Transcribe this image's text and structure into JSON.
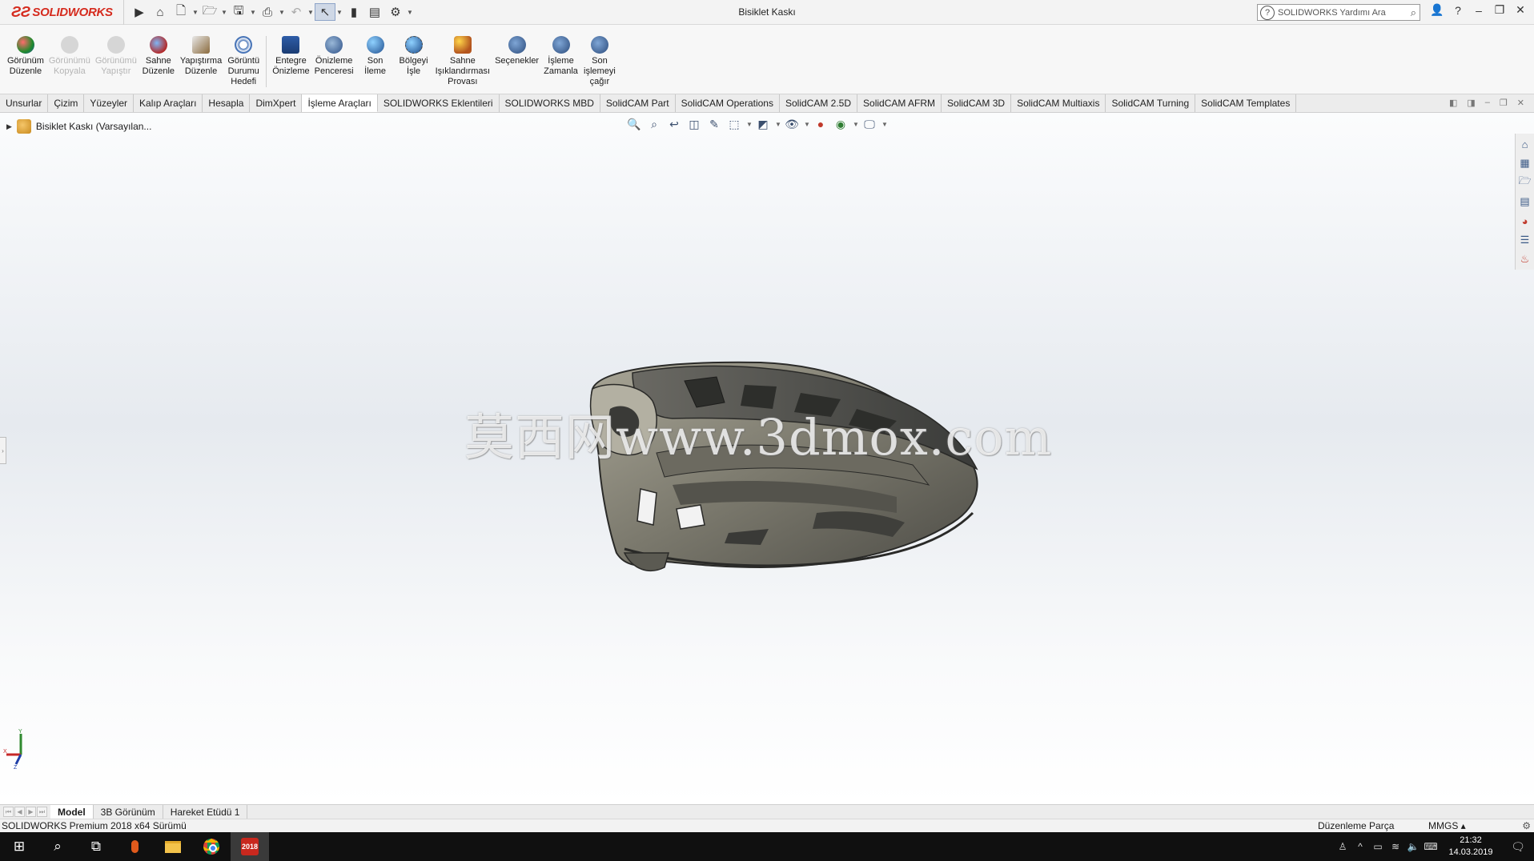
{
  "app": {
    "brand": "SOLIDWORKS",
    "window_title": "Bisiklet Kaskı",
    "help_search_placeholder": "SOLIDWORKS Yardımı Ara"
  },
  "ribbon": {
    "buttons": [
      {
        "label": "Görünüm\nDüzenle",
        "enabled": true
      },
      {
        "label": "Görünümü\nKopyala",
        "enabled": false
      },
      {
        "label": "Görünümü\nYapıştır",
        "enabled": false
      },
      {
        "label": "Sahne\nDüzenle",
        "enabled": true
      },
      {
        "label": "Yapıştırma\nDüzenle",
        "enabled": true
      },
      {
        "label": "Görüntü\nDurumu\nHedefi",
        "enabled": true
      },
      {
        "label": "Entegre\nÖnizleme",
        "enabled": true
      },
      {
        "label": "Önizleme\nPenceresi",
        "enabled": true
      },
      {
        "label": "Son\nİleme",
        "enabled": true
      },
      {
        "label": "Bölgeyi\nİşle",
        "enabled": true
      },
      {
        "label": "Sahne\nIşıklandırması\nProvası",
        "enabled": true
      },
      {
        "label": "Seçenekler",
        "enabled": true
      },
      {
        "label": "İşleme\nZamanla",
        "enabled": true
      },
      {
        "label": "Son\nişlemeyi\nçağır",
        "enabled": true
      }
    ]
  },
  "tabs": [
    "Unsurlar",
    "Çizim",
    "Yüzeyler",
    "Kalıp Araçları",
    "Hesapla",
    "DimXpert",
    "İşleme Araçları",
    "SOLIDWORKS Eklentileri",
    "SOLIDWORKS MBD",
    "SolidCAM Part",
    "SolidCAM Operations",
    "SolidCAM 2.5D",
    "SolidCAM AFRM",
    "SolidCAM 3D",
    "SolidCAM Multiaxis",
    "SolidCAM Turning",
    "SolidCAM Templates"
  ],
  "active_tab": "İşleme Araçları",
  "feature_tree": {
    "root_label": "Bisiklet Kaskı  (Varsayılan..."
  },
  "watermark": "莫西网www.3dmox.com",
  "triad": {
    "x": "X",
    "y": "Y",
    "z": "Z"
  },
  "bottom_tabs": [
    "Model",
    "3B Görünüm",
    "Hareket Etüdü 1"
  ],
  "active_bottom_tab": "Model",
  "status": {
    "version": "SOLIDWORKS Premium 2018 x64 Sürümü",
    "mode": "Düzenleme Parça",
    "units": "MMGS"
  },
  "taskbar": {
    "sw_badge": "2018",
    "time": "21:32",
    "date": "14.03.2019"
  },
  "colors": {
    "brand_red": "#d52b1e",
    "helmet_body": "#8c8a7e",
    "helmet_dark": "#3e3f3c"
  }
}
